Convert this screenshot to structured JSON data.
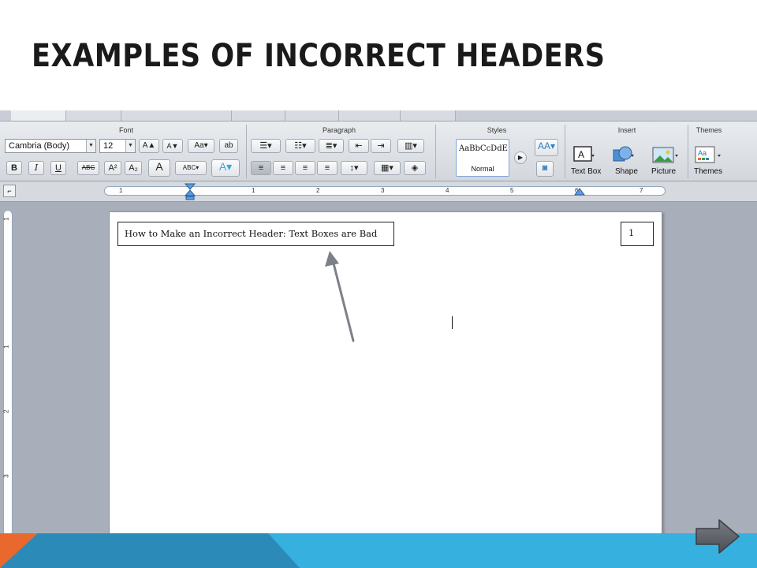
{
  "slide": {
    "title": "EXAMPLES OF INCORRECT HEADERS"
  },
  "ribbon": {
    "groups": {
      "font": "Font",
      "paragraph": "Paragraph",
      "styles": "Styles",
      "insert": "Insert",
      "themes": "Themes"
    },
    "font_name": "Cambria (Body)",
    "font_size": "12",
    "styles_sample": "AaBbCcDdEe",
    "styles_name": "Normal",
    "insert_buttons": {
      "text_box": "Text Box",
      "shape": "Shape",
      "picture": "Picture"
    },
    "themes_button": "Themes",
    "format_buttons": {
      "bold": "B",
      "italic": "I",
      "underline": "U",
      "strikethrough": "ABC",
      "superscript": "A²",
      "subscript": "A₂",
      "font_color": "A"
    }
  },
  "ruler": {
    "marks": [
      "1",
      "1",
      "2",
      "3",
      "4",
      "5",
      "6",
      "7"
    ]
  },
  "vruler": {
    "marks": [
      "1",
      "1",
      "2",
      "3"
    ]
  },
  "document": {
    "header_text": "How to Make an Incorrect Header: Text Boxes are Bad",
    "page_number": "1"
  },
  "colors": {
    "footer_blue": "#35b0df",
    "footer_dark": "#2b8ab8",
    "footer_orange": "#e9682d",
    "arrow": "#5c6066"
  },
  "icons": {
    "next": "right-arrow-icon",
    "annotation": "pointer-arrow-icon"
  }
}
